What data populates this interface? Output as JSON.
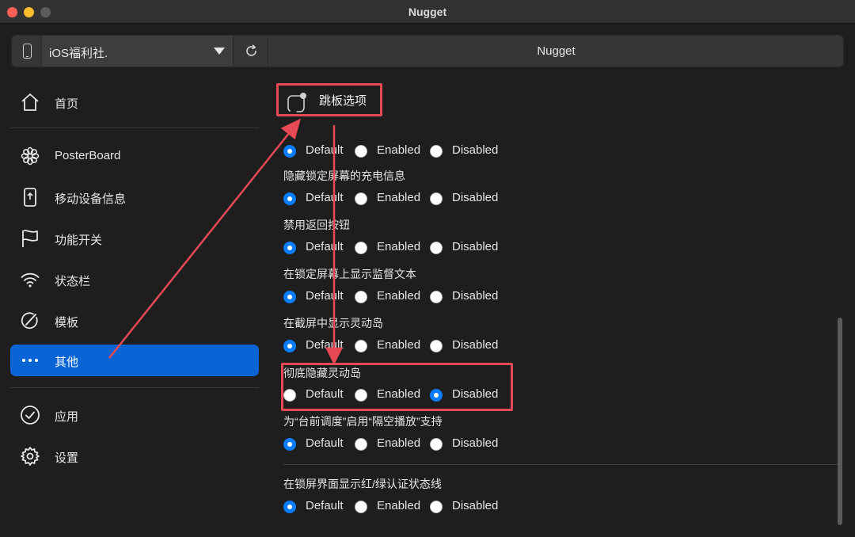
{
  "window": {
    "title": "Nugget"
  },
  "toolbar": {
    "device_name": "iOS福利社.",
    "center_title": "Nugget"
  },
  "sidebar": {
    "items": [
      {
        "label": "首页",
        "icon": "home-icon"
      },
      {
        "label": "PosterBoard",
        "icon": "flower-icon"
      },
      {
        "label": "移动设备信息",
        "icon": "phone-info-icon"
      },
      {
        "label": "功能开关",
        "icon": "flag-icon"
      },
      {
        "label": "状态栏",
        "icon": "wifi-icon"
      },
      {
        "label": "模板",
        "icon": "template-icon"
      },
      {
        "label": "其他",
        "icon": "ellipsis-icon",
        "active": true
      },
      {
        "label": "应用",
        "icon": "checkmark-circle-icon"
      },
      {
        "label": "设置",
        "icon": "gear-icon"
      }
    ]
  },
  "main": {
    "section_title": "跳板选项",
    "radio_labels": {
      "default": "Default",
      "enabled": "Enabled",
      "disabled": "Disabled"
    },
    "options": [
      {
        "label": "",
        "selected": "default"
      },
      {
        "label": "隐藏锁定屏幕的充电信息",
        "selected": "default"
      },
      {
        "label": "禁用返回按钮",
        "selected": "default"
      },
      {
        "label": "在锁定屏幕上显示监督文本",
        "selected": "default"
      },
      {
        "label": "在截屏中显示灵动岛",
        "selected": "default"
      },
      {
        "label": "彻底隐藏灵动岛",
        "selected": "disabled"
      },
      {
        "label": "为“台前调度”启用“隔空播放”支持",
        "selected": "default"
      },
      {
        "label": "在锁屏界面显示红/绿认证状态线",
        "selected": "default"
      }
    ]
  },
  "colors": {
    "accent": "#0a64d6",
    "annotation": "#e64a55",
    "radio_selected": "#0a7cff"
  }
}
